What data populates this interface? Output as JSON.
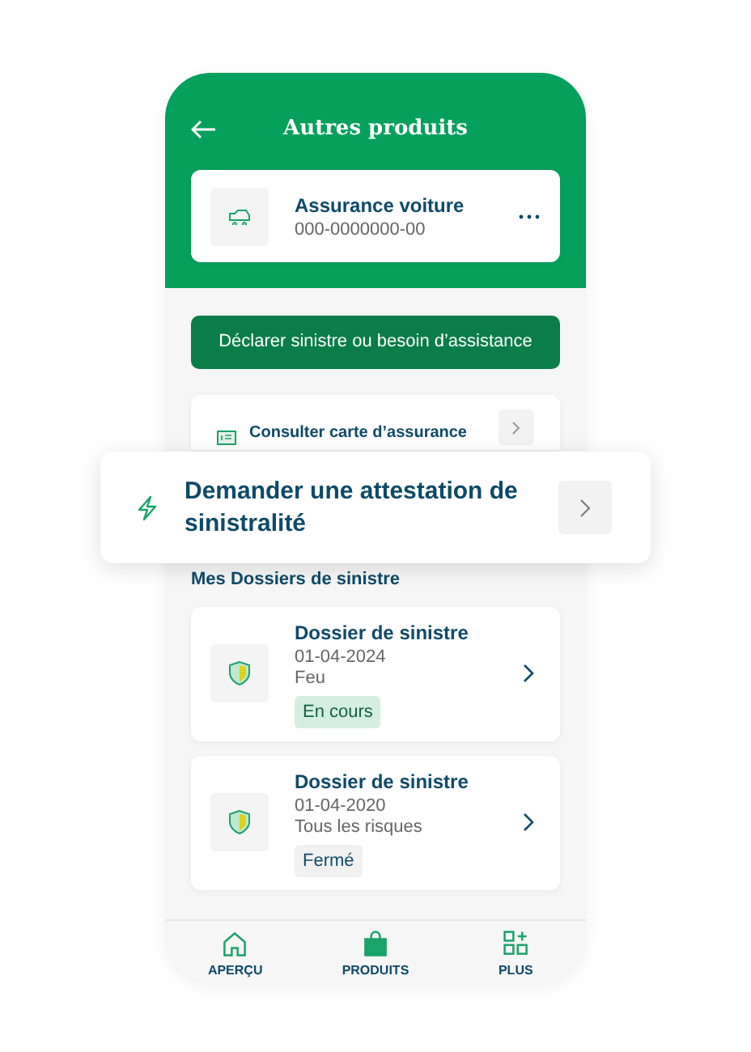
{
  "header": {
    "title": "Autres produits"
  },
  "product": {
    "name": "Assurance voiture",
    "number": "000-0000000-00"
  },
  "declare_button": "Déclarer sinistre ou besoin d’assistance",
  "consult_card": {
    "label": "Consulter carte d’assurance"
  },
  "attestation_card": {
    "label": "Demander une attestation de sinistralité"
  },
  "section_title": "Mes Dossiers de sinistre",
  "dossiers": [
    {
      "title": "Dossier de sinistre",
      "date": "01-04-2024",
      "type": "Feu",
      "status": "En cours",
      "kind": "active"
    },
    {
      "title": "Dossier de sinistre",
      "date": "01-04-2020",
      "type": "Tous les risques",
      "status": "Fermé",
      "kind": "closed"
    }
  ],
  "nav": [
    {
      "label": "APERÇU",
      "selected": false
    },
    {
      "label": "PRODUITS",
      "selected": true
    },
    {
      "label": "PLUS",
      "selected": false
    }
  ]
}
